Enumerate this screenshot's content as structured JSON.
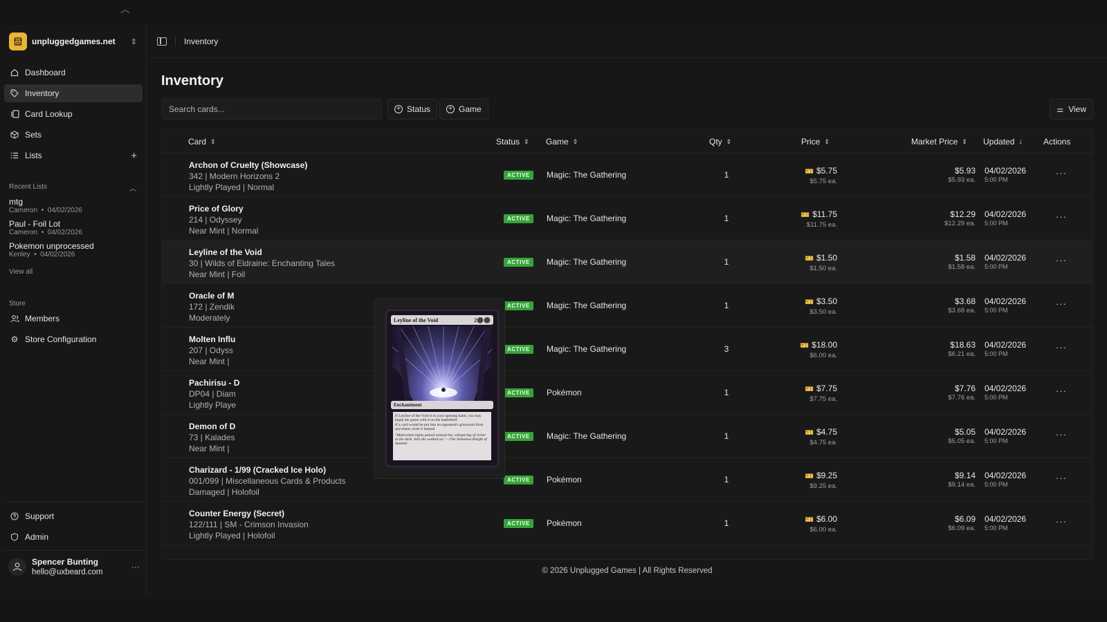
{
  "sidebar": {
    "store_name": "unpluggedgames.net",
    "nav": [
      {
        "label": "Dashboard",
        "icon": "home-icon"
      },
      {
        "label": "Inventory",
        "icon": "tag-icon",
        "active": true
      },
      {
        "label": "Card Lookup",
        "icon": "cards-icon"
      },
      {
        "label": "Sets",
        "icon": "box-icon"
      },
      {
        "label": "Lists",
        "icon": "list-icon"
      }
    ],
    "recent_lists_label": "Recent Lists",
    "recent_lists": [
      {
        "name": "mtg",
        "owner": "Cameron",
        "date": "04/02/2026"
      },
      {
        "name": "Paul - Foil Lot",
        "owner": "Cameron",
        "date": "04/02/2026"
      },
      {
        "name": "Pokemon unprocessed",
        "owner": "Kenley",
        "date": "04/02/2026"
      }
    ],
    "view_all": "View all",
    "store_label": "Store",
    "store_nav": [
      {
        "label": "Members",
        "icon": "users-icon"
      },
      {
        "label": "Store Configuration",
        "icon": "gear-icon"
      }
    ],
    "bottom_nav": [
      {
        "label": "Support",
        "icon": "help-icon"
      },
      {
        "label": "Admin",
        "icon": "shield-icon"
      }
    ],
    "user": {
      "name": "Spencer Bunting",
      "email": "hello@uxbeard.com"
    }
  },
  "header": {
    "breadcrumb": "Inventory"
  },
  "page": {
    "title": "Inventory",
    "search_placeholder": "Search cards...",
    "filters": [
      "Status",
      "Game"
    ],
    "view_label": "View"
  },
  "table": {
    "columns": {
      "card": "Card",
      "status": "Status",
      "game": "Game",
      "qty": "Qty",
      "price": "Price",
      "market_price": "Market Price",
      "updated": "Updated",
      "actions": "Actions"
    },
    "rows": [
      {
        "name": "Archon of Cruelty (Showcase)",
        "set": "342 | Modern Horizons 2",
        "cond": "Lightly Played | Normal",
        "status": "ACTIVE",
        "game": "Magic: The Gathering",
        "qty": "1",
        "price": "$5.75",
        "price_ea": "$5.75 ea.",
        "market": "$5.93",
        "market_ea": "$5.93 ea.",
        "date": "04/02/2026",
        "time": "5:00 PM"
      },
      {
        "name": "Price of Glory",
        "set": "214 | Odyssey",
        "cond": "Near Mint | Normal",
        "status": "ACTIVE",
        "game": "Magic: The Gathering",
        "qty": "1",
        "price": "$11.75",
        "price_ea": "$11.75 ea.",
        "market": "$12.29",
        "market_ea": "$12.29 ea.",
        "date": "04/02/2026",
        "time": "5:00 PM"
      },
      {
        "name": "Leyline of the Void",
        "set": "30 | Wilds of Eldraine: Enchanting Tales",
        "cond": "Near Mint | Foil",
        "status": "ACTIVE",
        "game": "Magic: The Gathering",
        "qty": "1",
        "price": "$1.50",
        "price_ea": "$1.50 ea.",
        "market": "$1.58",
        "market_ea": "$1.58 ea.",
        "date": "04/02/2026",
        "time": "5:00 PM"
      },
      {
        "name": "Oracle of M",
        "set": "172 | Zendik",
        "cond": "Moderately",
        "status": "ACTIVE",
        "game": "Magic: The Gathering",
        "qty": "1",
        "price": "$3.50",
        "price_ea": "$3.50 ea.",
        "market": "$3.68",
        "market_ea": "$3.68 ea.",
        "date": "04/02/2026",
        "time": "5:00 PM"
      },
      {
        "name": "Molten Influ",
        "set": "207 | Odyss",
        "cond": "Near Mint |",
        "status": "ACTIVE",
        "game": "Magic: The Gathering",
        "qty": "3",
        "price": "$18.00",
        "price_ea": "$6.00 ea.",
        "market": "$18.63",
        "market_ea": "$6.21 ea.",
        "date": "04/02/2026",
        "time": "5:00 PM"
      },
      {
        "name": "Pachirisu - D",
        "set": "DP04 | Diam",
        "cond": "Lightly Playe",
        "status": "ACTIVE",
        "game": "Pokémon",
        "qty": "1",
        "price": "$7.75",
        "price_ea": "$7.75 ea.",
        "market": "$7.76",
        "market_ea": "$7.76 ea.",
        "date": "04/02/2026",
        "time": "5:00 PM"
      },
      {
        "name": "Demon of D",
        "set": "73 | Kalades",
        "cond": "Near Mint |",
        "status": "ACTIVE",
        "game": "Magic: The Gathering",
        "qty": "1",
        "price": "$4.75",
        "price_ea": "$4.75 ea.",
        "market": "$5.05",
        "market_ea": "$5.05 ea.",
        "date": "04/02/2026",
        "time": "5:00 PM"
      },
      {
        "name": "Charizard - 1/99 (Cracked Ice Holo)",
        "set": "001/099 | Miscellaneous Cards & Products",
        "cond": "Damaged | Holofoil",
        "status": "ACTIVE",
        "game": "Pokémon",
        "qty": "1",
        "price": "$9.25",
        "price_ea": "$9.25 ea.",
        "market": "$9.14",
        "market_ea": "$9.14 ea.",
        "date": "04/02/2026",
        "time": "5:00 PM"
      },
      {
        "name": "Counter Energy (Secret)",
        "set": "122/111 | SM - Crimson Invasion",
        "cond": "Lightly Played | Holofoil",
        "status": "ACTIVE",
        "game": "Pokémon",
        "qty": "1",
        "price": "$6.00",
        "price_ea": "$6.00 ea.",
        "market": "$6.09",
        "market_ea": "$6.09 ea.",
        "date": "04/02/2026",
        "time": "5:00 PM"
      }
    ]
  },
  "preview_card": {
    "name": "Leyline of the Void",
    "cost": "2⚫⚫",
    "type_line": "Enchantment",
    "rules_1": "If Leyline of the Void is in your opening hand, you may begin the game with it on the battlefield.",
    "rules_2": "If a card would be put into an opponent's graveyard from anywhere, exile it instead.",
    "flavor": "\"Malevolent lights pulsed around her, whispering of richer in the dark. Still she walked on.\" —The Nameless Knight of Summer"
  },
  "footer": "© 2026 Unplugged Games | All Rights Reserved",
  "colors": {
    "accent_badge": "#36a33a",
    "brand_logo": "#e8b43a"
  }
}
